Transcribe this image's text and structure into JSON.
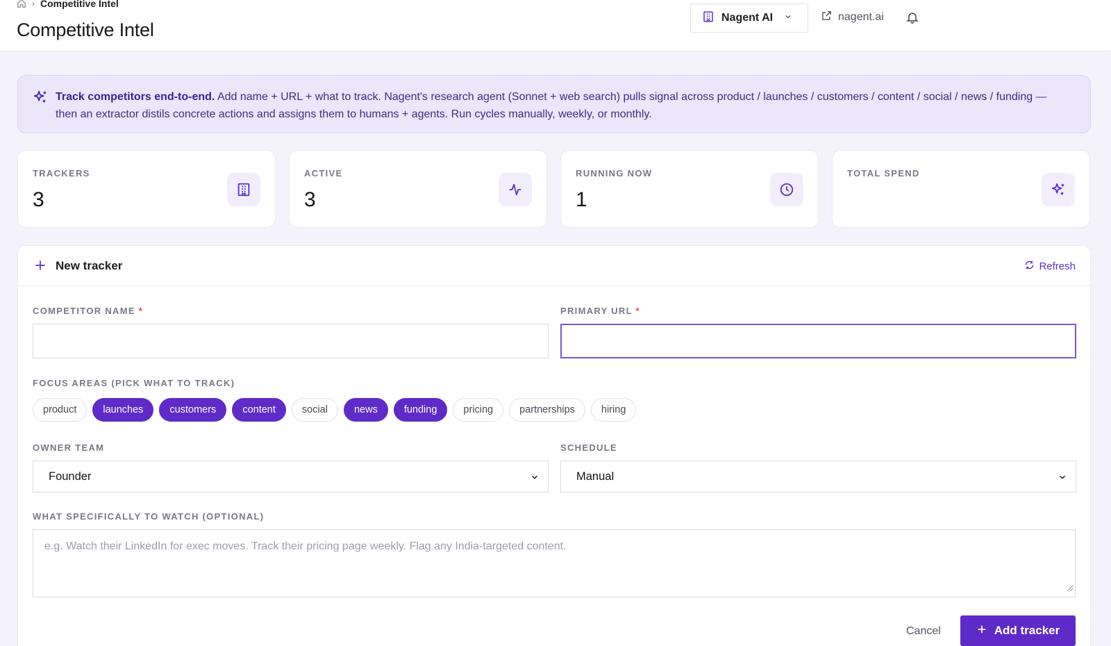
{
  "breadcrumb": {
    "current": "Competitive Intel"
  },
  "page": {
    "title": "Competitive Intel"
  },
  "header": {
    "org_label": "Nagent AI",
    "site_link": "nagent.ai"
  },
  "banner": {
    "strong": "Track competitors end-to-end.",
    "text": " Add name + URL + what to track. Nagent's research agent (Sonnet + web search) pulls signal across product / launches / customers / content / social / news / funding — then an extractor distils concrete actions and assigns them to humans + agents. Run cycles manually, weekly, or monthly."
  },
  "stats": [
    {
      "label": "TRACKERS",
      "value": "3",
      "icon": "building-icon"
    },
    {
      "label": "ACTIVE",
      "value": "3",
      "icon": "activity-icon"
    },
    {
      "label": "RUNNING NOW",
      "value": "1",
      "icon": "clock-icon"
    },
    {
      "label": "TOTAL SPEND",
      "value": "",
      "icon": "sparkles-icon"
    }
  ],
  "form": {
    "title": "New tracker",
    "refresh_label": "Refresh",
    "competitor_name_label": "COMPETITOR NAME",
    "competitor_name_value": "",
    "primary_url_label": "PRIMARY URL",
    "primary_url_value": "",
    "required_mark": "*",
    "focus_label": "FOCUS AREAS (PICK WHAT TO TRACK)",
    "focus_areas": [
      {
        "label": "product",
        "selected": false
      },
      {
        "label": "launches",
        "selected": true
      },
      {
        "label": "customers",
        "selected": true
      },
      {
        "label": "content",
        "selected": true
      },
      {
        "label": "social",
        "selected": false
      },
      {
        "label": "news",
        "selected": true
      },
      {
        "label": "funding",
        "selected": true
      },
      {
        "label": "pricing",
        "selected": false
      },
      {
        "label": "partnerships",
        "selected": false
      },
      {
        "label": "hiring",
        "selected": false
      }
    ],
    "owner_team_label": "OWNER TEAM",
    "owner_team_value": "Founder",
    "schedule_label": "SCHEDULE",
    "schedule_value": "Manual",
    "watch_label": "WHAT SPECIFICALLY TO WATCH (OPTIONAL)",
    "watch_placeholder": "e.g. Watch their LinkedIn for exec moves. Track their pricing page weekly. Flag any India-targeted content.",
    "cancel_label": "Cancel",
    "submit_label": "Add tracker"
  },
  "colors": {
    "accent": "#5e2bc9",
    "banner_bg": "#ebe6f9",
    "page_bg": "#f4f2fb",
    "required": "#e0404a"
  }
}
